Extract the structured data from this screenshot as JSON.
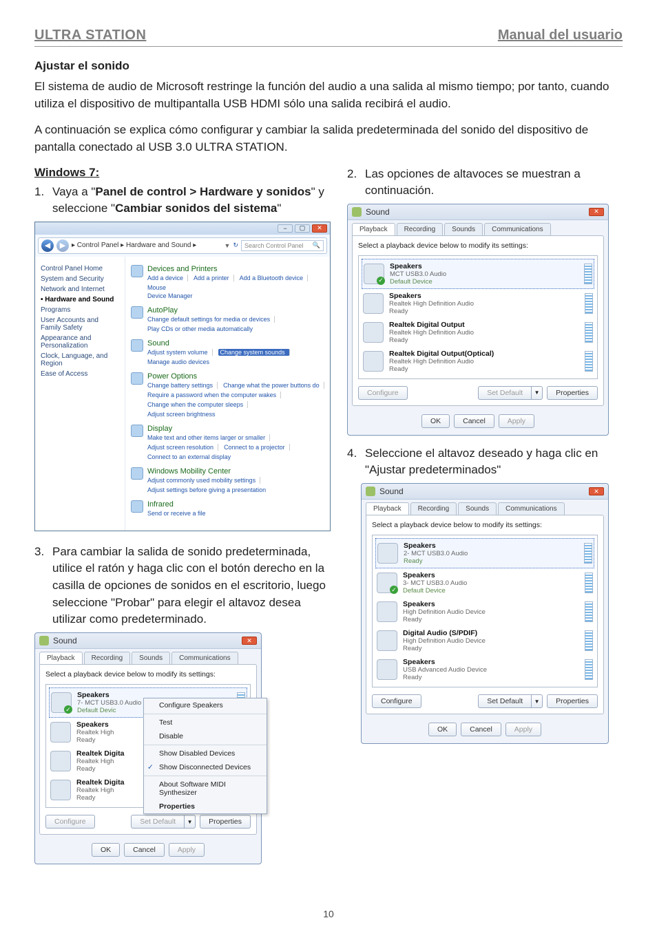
{
  "header": {
    "left": "ULTRA STATION",
    "right": "Manual del usuario"
  },
  "section_title": "Ajustar el sonido",
  "para1": "El sistema de audio de Microsoft restringe la función del audio a una salida al mismo tiempo; por tanto, cuando utiliza el dispositivo de multipantalla USB HDMI sólo una salida recibirá el audio.",
  "para2": "A continuación se explica cómo configurar y cambiar la salida predeterminada del sonido del dispositivo de pantalla conectado al USB 3.0 ULTRA STATION.",
  "win7": "Windows 7:",
  "step1_pre": "Vaya a \"",
  "step1_bold1": "Panel de control > Hardware y sonidos",
  "step1_mid": "\" y seleccione \"",
  "step1_bold2": "Cambiar sonidos del sistema",
  "step1_post": "\"",
  "step2": "Las opciones de altavoces se muestran a continuación.",
  "step3": "Para cambiar la salida de sonido predeterminada, utilice el ratón y haga clic con el botón derecho en la casilla de opciones de sonidos en el escritorio, luego seleccione \"Probar\" para elegir el altavoz desea utilizar como predeterminado.",
  "step4": "Seleccione el altavoz deseado y haga clic en \"Ajustar predeterminados\"",
  "cp": {
    "path": "▸ Control Panel ▸ Hardware and Sound ▸",
    "search_ph": "Search Control Panel",
    "side": [
      "Control Panel Home",
      "System and Security",
      "Network and Internet",
      "Hardware and Sound",
      "Programs",
      "User Accounts and Family Safety",
      "Appearance and Personalization",
      "Clock, Language, and Region",
      "Ease of Access"
    ],
    "groups": [
      {
        "title": "Devices and Printers",
        "links": [
          "Add a device",
          "Add a printer",
          "Add a Bluetooth device",
          "Mouse"
        ],
        "extra": "Device Manager"
      },
      {
        "title": "AutoPlay",
        "links": [
          "Change default settings for media or devices",
          "Play CDs or other media automatically"
        ]
      },
      {
        "title": "Sound",
        "links": [
          "Adjust system volume"
        ],
        "hl": "Change system sounds",
        "tail": [
          "Manage audio devices"
        ]
      },
      {
        "title": "Power Options",
        "links": [
          "Change battery settings",
          "Change what the power buttons do",
          "Require a password when the computer wakes",
          "Change when the computer sleeps",
          "Adjust screen brightness"
        ]
      },
      {
        "title": "Display",
        "links": [
          "Make text and other items larger or smaller",
          "Adjust screen resolution",
          "Connect to a projector",
          "Connect to an external display"
        ]
      },
      {
        "title": "Windows Mobility Center",
        "links": [
          "Adjust commonly used mobility settings",
          "Adjust settings before giving a presentation"
        ]
      },
      {
        "title": "Infrared",
        "links": [
          "Send or receive a file"
        ]
      }
    ]
  },
  "sound": {
    "title": "Sound",
    "tabs": [
      "Playback",
      "Recording",
      "Sounds",
      "Communications"
    ],
    "instr": "Select a playback device below to modify its settings:",
    "btn_configure": "Configure",
    "btn_setdefault": "Set Default",
    "btn_properties": "Properties",
    "btn_ok": "OK",
    "btn_cancel": "Cancel",
    "btn_apply": "Apply"
  },
  "dlg2_devices": [
    {
      "name": "Speakers",
      "sub": "MCT USB3.0 Audio",
      "state": "Default Device",
      "sel": true,
      "chk": true
    },
    {
      "name": "Speakers",
      "sub": "Realtek High Definition Audio",
      "state": "Ready"
    },
    {
      "name": "Realtek Digital Output",
      "sub": "Realtek High Definition Audio",
      "state": "Ready"
    },
    {
      "name": "Realtek Digital Output(Optical)",
      "sub": "Realtek High Definition Audio",
      "state": "Ready"
    }
  ],
  "dlg3_devices": [
    {
      "name": "Speakers",
      "sub": "7- MCT USB3.0 Audio",
      "state": "Default Devic",
      "sel": true,
      "chk": true
    },
    {
      "name": "Speakers",
      "sub": "Realtek High",
      "state": "Ready"
    },
    {
      "name": "Realtek Digita",
      "sub": "Realtek High",
      "state": "Ready"
    },
    {
      "name": "Realtek Digita",
      "sub": "Realtek High",
      "state": "Ready"
    }
  ],
  "ctx": {
    "items": [
      {
        "label": "Configure Speakers"
      },
      {
        "label": "Test",
        "sep": true
      },
      {
        "label": "Disable"
      },
      {
        "label": "Show Disabled Devices",
        "sep": true
      },
      {
        "label": "Show Disconnected Devices",
        "chk": true
      },
      {
        "label": "About Software MIDI Synthesizer",
        "sep": true
      },
      {
        "label": "Properties",
        "bold": true
      }
    ]
  },
  "dlg4_devices": [
    {
      "name": "Speakers",
      "sub": "2- MCT USB3.0 Audio",
      "state": "Ready",
      "sel": true
    },
    {
      "name": "Speakers",
      "sub": "3- MCT USB3.0 Audio",
      "state": "Default Device",
      "chk": true
    },
    {
      "name": "Speakers",
      "sub": "High Definition Audio Device",
      "state": "Ready"
    },
    {
      "name": "Digital Audio (S/PDIF)",
      "sub": "High Definition Audio Device",
      "state": "Ready"
    },
    {
      "name": "Speakers",
      "sub": "USB Advanced Audio Device",
      "state": "Ready"
    }
  ],
  "page_num": "10"
}
